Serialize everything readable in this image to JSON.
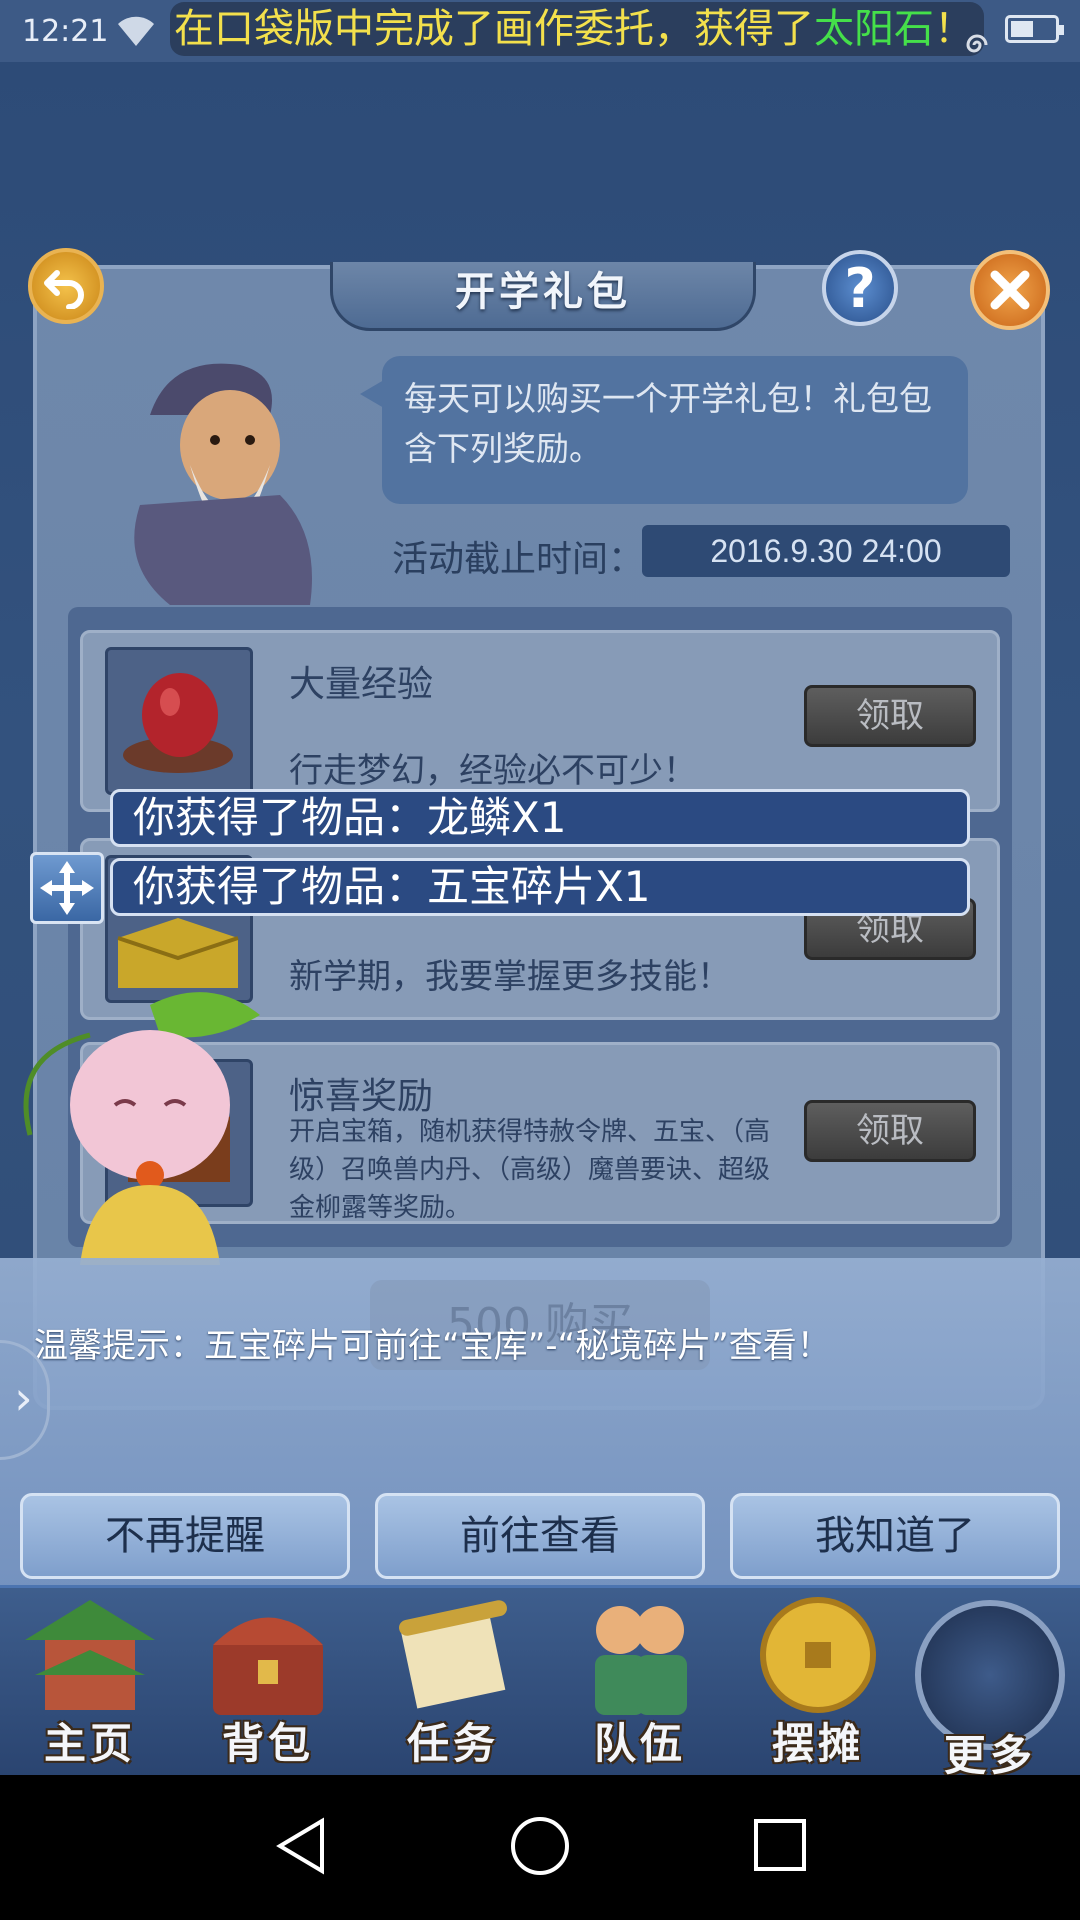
{
  "status_bar": {
    "time": "12:21",
    "marquee_prefix": "在口袋版中完成了画作委托，获得了",
    "marquee_highlight": "太阳石",
    "marquee_suffix": "！"
  },
  "dialog": {
    "title": "开学礼包",
    "help_label": "?",
    "speech": "每天可以购买一个开学礼包！礼包包含下列奖励。",
    "deadline_label": "活动截止时间：",
    "deadline_value": "2016.9.30   24:00",
    "items": [
      {
        "name": "大量经验",
        "desc": "行走梦幻，经验必不可少！",
        "button": "领取",
        "icon": "red-fruit-icon"
      },
      {
        "name": "",
        "desc": "新学期，我要掌握更多技能！",
        "button": "领取",
        "icon": "gold-book-icon"
      },
      {
        "name": "惊喜奖励",
        "desc": "开启宝箱，随机获得特赦令牌、五宝、（高级）召唤兽内丹、（高级）魔兽要诀、超级金柳露等奖励。",
        "button": "领取",
        "icon": "treasure-chest-icon"
      }
    ],
    "buy_button": "500  购买"
  },
  "notifications": [
    "你获得了物品：龙鳞X1",
    "你获得了物品：五宝碎片X1"
  ],
  "tip": {
    "text": "温馨提示：五宝碎片可前往“宝库”-“秘境碎片”查看！",
    "buttons": [
      "不再提醒",
      "前往查看",
      "我知道了"
    ]
  },
  "bottom_nav": [
    {
      "label": "主页",
      "icon": "pagoda-icon"
    },
    {
      "label": "背包",
      "icon": "chest-icon"
    },
    {
      "label": "任务",
      "icon": "scroll-icon"
    },
    {
      "label": "队伍",
      "icon": "team-icon"
    },
    {
      "label": "摆摊",
      "icon": "coin-icon"
    },
    {
      "label": "更多",
      "icon": "more-icon"
    }
  ]
}
